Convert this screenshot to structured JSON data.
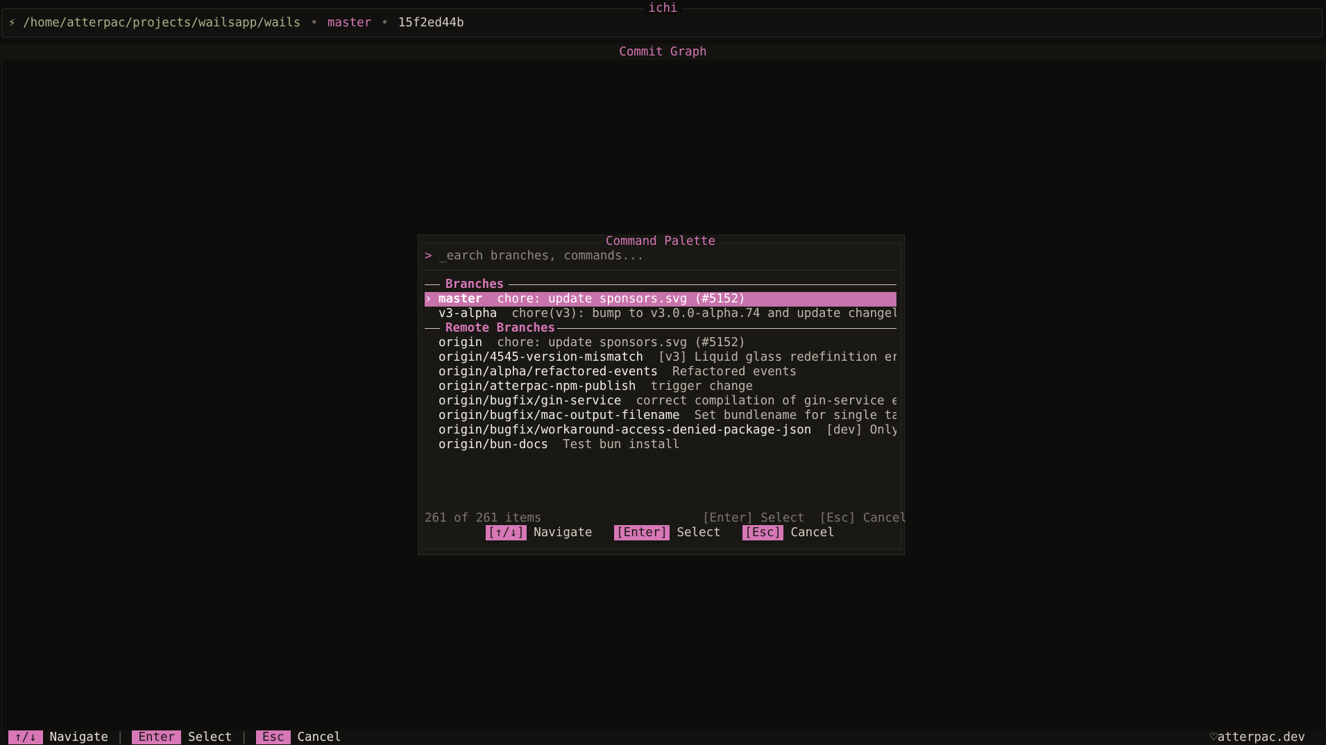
{
  "app": {
    "title": "ichi",
    "repo_icon": "plug-icon",
    "repo_path": "/home/atterpac/projects/wailsapp/wails",
    "separator": "•",
    "branch": "master",
    "commit": "15f2ed44b"
  },
  "graph": {
    "title": "Commit Graph"
  },
  "palette": {
    "title": "Command Palette",
    "prompt": ">",
    "search_placeholder": "_earch branches, commands...",
    "sections": {
      "branches": "Branches",
      "remote": "Remote Branches"
    },
    "branches": [
      {
        "marker": "›",
        "name": "master",
        "message": "chore: update sponsors.svg (#5152)",
        "selected": true
      },
      {
        "marker": "",
        "name": "v3-alpha",
        "message": "chore(v3): bump to v3.0.0-alpha.74 and update changel...",
        "selected": false
      }
    ],
    "remote_branches": [
      {
        "name": "origin",
        "message": "chore: update sponsors.svg (#5152)"
      },
      {
        "name": "origin/4545-version-mismatch",
        "message": "[v3] Liquid glass redefinition er..."
      },
      {
        "name": "origin/alpha/refactored-events",
        "message": "Refactored events"
      },
      {
        "name": "origin/atterpac-npm-publish",
        "message": "trigger change"
      },
      {
        "name": "origin/bugfix/gin-service",
        "message": "correct compilation of gin-service e..."
      },
      {
        "name": "origin/bugfix/mac-output-filename",
        "message": "Set bundlename for single ta..."
      },
      {
        "name": "origin/bugfix/workaround-access-denied-package-json",
        "message": "[dev] Only..."
      },
      {
        "name": "origin/bun-docs",
        "message": "Test bun install"
      }
    ],
    "count": "261 of 261 items",
    "hint": "[Enter] Select  [Esc] Cancel",
    "keys": [
      {
        "key": "[↑/↓]",
        "label": "Navigate"
      },
      {
        "key": "[Enter]",
        "label": "Select"
      },
      {
        "key": "[Esc]",
        "label": "Cancel"
      }
    ]
  },
  "statusbar": {
    "keys": [
      {
        "key": "↑/↓",
        "label": "Navigate"
      },
      {
        "key": "Enter",
        "label": "Select"
      },
      {
        "key": "Esc",
        "label": "Cancel"
      }
    ],
    "divider": "|",
    "right_icon": "heart-icon",
    "right_text": "atterpac.dev"
  },
  "colors": {
    "accent": "#d777b6",
    "background": "#0e0d0b",
    "path": "#a8b58a"
  }
}
